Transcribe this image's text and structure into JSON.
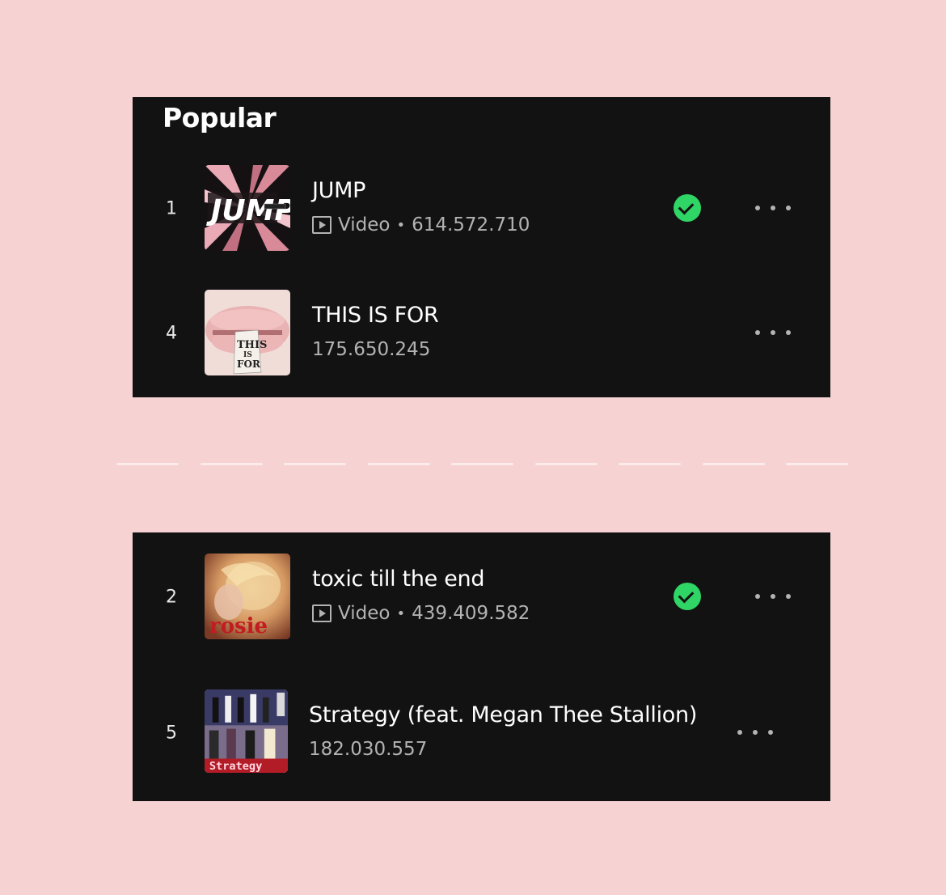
{
  "section_title": "Popular",
  "tracks": [
    {
      "rank": "1",
      "title": "JUMP",
      "meta_type": "Video",
      "meta_sep": "•",
      "plays": "614.572.710",
      "saved": true,
      "art_label": "JUMP"
    },
    {
      "rank": "4",
      "title": "THIS IS FOR",
      "meta_type": "",
      "plays": "175.650.245",
      "saved": false,
      "art_label_1": "THIS",
      "art_label_2": "IS",
      "art_label_3": "FOR"
    },
    {
      "rank": "2",
      "title": "toxic till the end",
      "meta_type": "Video",
      "meta_sep": "•",
      "plays": "439.409.582",
      "saved": true,
      "art_label": "rosie"
    },
    {
      "rank": "5",
      "title": "Strategy (feat. Megan Thee Stallion)",
      "meta_type": "",
      "plays": "182.030.557",
      "saved": false,
      "art_label": "Strategy"
    }
  ],
  "colors": {
    "page_background": "#f6d2d3",
    "panel_background": "#121212",
    "saved_badge": "#2fd565",
    "secondary_text": "#b3b3b3"
  },
  "icons": [
    "video-icon",
    "check-icon",
    "more-icon"
  ]
}
